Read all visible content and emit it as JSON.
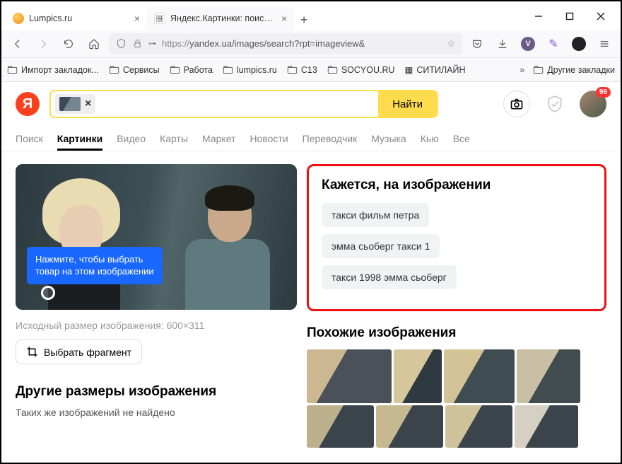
{
  "browser": {
    "tabs": [
      {
        "title": "Lumpics.ru"
      },
      {
        "title": "Яндекс.Картинки: поиск по из"
      }
    ],
    "url_scheme": "https://",
    "url_rest": "yandex.ua/images/search?rpt=imageview&",
    "bookmarks": {
      "import": "Импорт закладок...",
      "items": [
        "Сервисы",
        "Работа",
        "lumpics.ru",
        "C13",
        "SOCYOU.RU",
        "СИТИЛАЙН"
      ],
      "other": "Другие закладки"
    }
  },
  "yandex": {
    "logo_letter": "Я",
    "search_button": "Найти",
    "badge": "99",
    "nav": [
      "Поиск",
      "Картинки",
      "Видео",
      "Карты",
      "Маркет",
      "Новости",
      "Переводчик",
      "Музыка",
      "Кью",
      "Все"
    ],
    "active_nav_index": 1
  },
  "left_panel": {
    "hint_l1": "Нажмите, чтобы выбрать",
    "hint_l2": "товар на этом изображении",
    "meta": "Исходный размер изображения: 600×311",
    "crop": "Выбрать фрагмент",
    "other_sizes_h": "Другие размеры изображения",
    "other_sizes_sub": "Таких же изображений не найдено"
  },
  "right_panel": {
    "seems_h": "Кажется, на изображении",
    "suggestions": [
      "такси фильм петра",
      "эмма сьоберг такси 1",
      "такси 1998 эмма сьоберг"
    ],
    "similar_h": "Похожие изображения"
  }
}
